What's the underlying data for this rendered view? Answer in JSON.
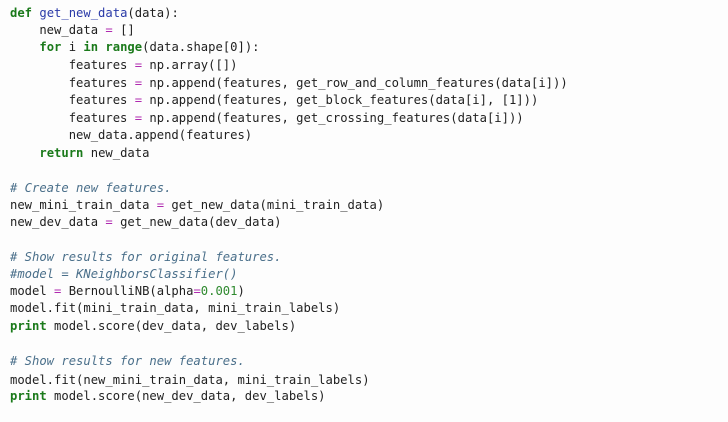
{
  "code": {
    "lines": [
      [
        {
          "t": "def",
          "c": "kw"
        },
        {
          "t": " ",
          "c": ""
        },
        {
          "t": "get_new_data",
          "c": "fn"
        },
        {
          "t": "(data):",
          "c": ""
        }
      ],
      [
        {
          "t": "    new_data ",
          "c": ""
        },
        {
          "t": "=",
          "c": "op"
        },
        {
          "t": " []",
          "c": ""
        }
      ],
      [
        {
          "t": "    ",
          "c": ""
        },
        {
          "t": "for",
          "c": "kw"
        },
        {
          "t": " i ",
          "c": ""
        },
        {
          "t": "in",
          "c": "kw"
        },
        {
          "t": " ",
          "c": ""
        },
        {
          "t": "range",
          "c": "kw"
        },
        {
          "t": "(data.shape[0]):",
          "c": ""
        }
      ],
      [
        {
          "t": "        features ",
          "c": ""
        },
        {
          "t": "=",
          "c": "op"
        },
        {
          "t": " np.array([])",
          "c": ""
        }
      ],
      [
        {
          "t": "        features ",
          "c": ""
        },
        {
          "t": "=",
          "c": "op"
        },
        {
          "t": " np.append(features, get_row_and_column_features(data[i]))",
          "c": ""
        }
      ],
      [
        {
          "t": "        features ",
          "c": ""
        },
        {
          "t": "=",
          "c": "op"
        },
        {
          "t": " np.append(features, get_block_features(data[i], [1]))",
          "c": ""
        }
      ],
      [
        {
          "t": "        features ",
          "c": ""
        },
        {
          "t": "=",
          "c": "op"
        },
        {
          "t": " np.append(features, get_crossing_features(data[i]))",
          "c": ""
        }
      ],
      [
        {
          "t": "        new_data.append(features)",
          "c": ""
        }
      ],
      [
        {
          "t": "    ",
          "c": ""
        },
        {
          "t": "return",
          "c": "kw"
        },
        {
          "t": " new_data",
          "c": ""
        }
      ],
      [],
      [
        {
          "t": "# Create new features.",
          "c": "cm"
        }
      ],
      [
        {
          "t": "new_mini_train_data ",
          "c": ""
        },
        {
          "t": "=",
          "c": "op"
        },
        {
          "t": " get_new_data(mini_train_data)",
          "c": ""
        }
      ],
      [
        {
          "t": "new_dev_data ",
          "c": ""
        },
        {
          "t": "=",
          "c": "op"
        },
        {
          "t": " get_new_data(dev_data)",
          "c": ""
        }
      ],
      [],
      [
        {
          "t": "# Show results for original features.",
          "c": "cm"
        }
      ],
      [
        {
          "t": "#model = KNeighborsClassifier()",
          "c": "cm"
        }
      ],
      [
        {
          "t": "model ",
          "c": ""
        },
        {
          "t": "=",
          "c": "op"
        },
        {
          "t": " BernoulliNB(alpha",
          "c": ""
        },
        {
          "t": "=",
          "c": "op"
        },
        {
          "t": "0.001",
          "c": "num"
        },
        {
          "t": ")",
          "c": ""
        }
      ],
      [
        {
          "t": "model.fit(mini_train_data, mini_train_labels)",
          "c": ""
        }
      ],
      [
        {
          "t": "print",
          "c": "kw"
        },
        {
          "t": " model.score(dev_data, dev_labels)",
          "c": ""
        }
      ],
      [],
      [
        {
          "t": "# Show results for new features.",
          "c": "cm"
        }
      ],
      [
        {
          "t": "model.fit(new_mini_train_data, mini_train_labels)",
          "c": ""
        }
      ],
      [
        {
          "t": "print",
          "c": "kw"
        },
        {
          "t": " model.score(new_dev_data, dev_labels)",
          "c": ""
        }
      ]
    ]
  },
  "colors": {
    "keyword": "#1b7a1b",
    "function_name": "#2a3aa8",
    "operator": "#b02ab0",
    "number": "#2f8a2f",
    "comment": "#4a6f8a",
    "text": "#1f1f1f",
    "background": "#fdfdfd"
  }
}
